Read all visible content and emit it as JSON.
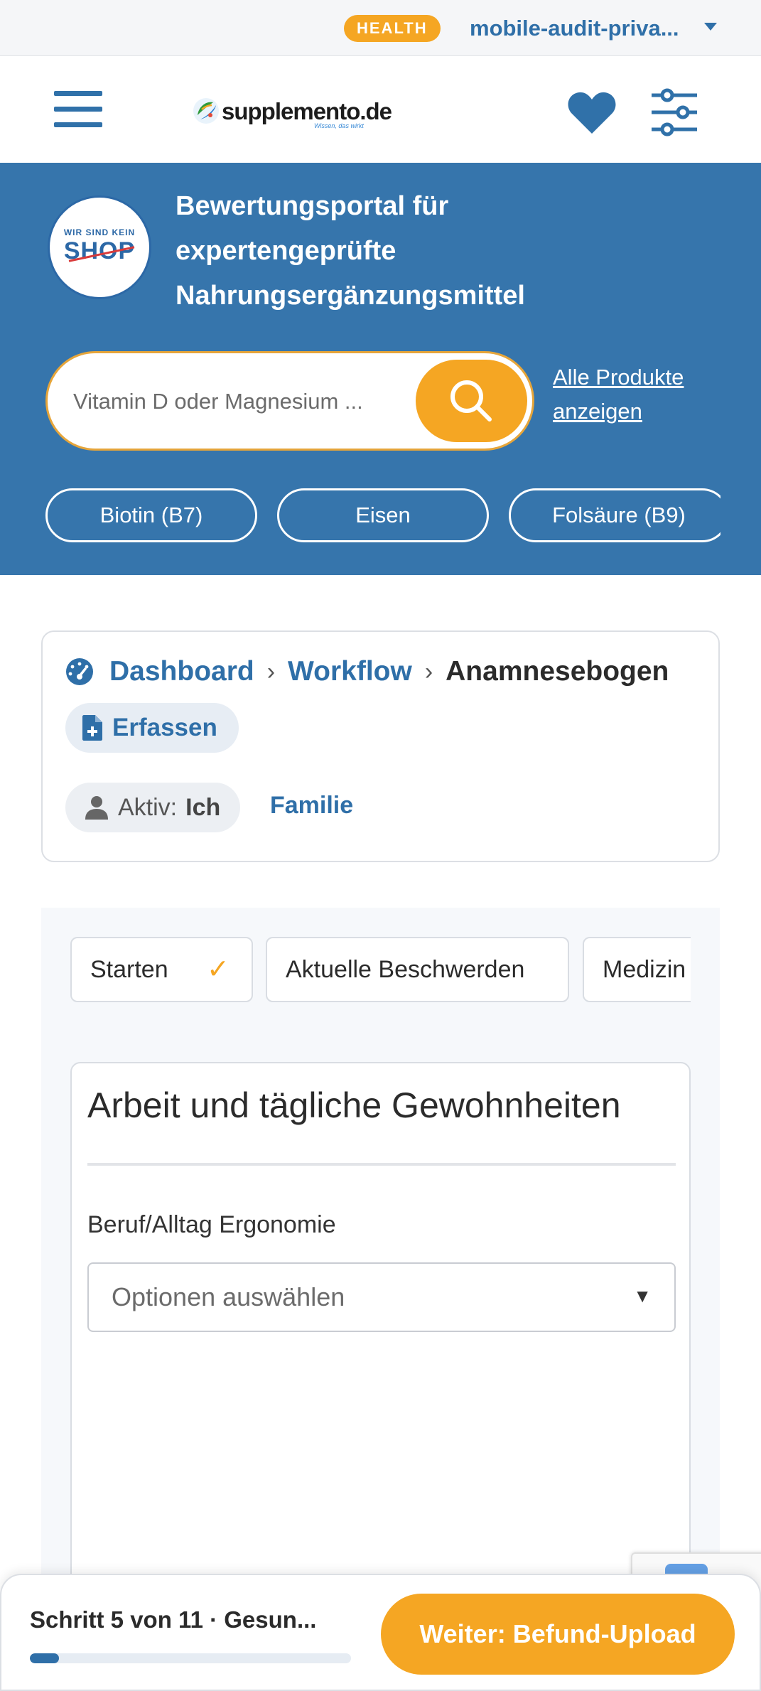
{
  "account_bar": {
    "badge": "HEALTH",
    "account_name": "mobile-audit-priva...",
    "colors": {
      "badge": "#f5a623",
      "link": "#2f6fa8"
    }
  },
  "header": {
    "menu_icon": "hamburger-menu-icon",
    "logo": {
      "name": "supplemento.de",
      "tagline": "Wissen, das wirkt"
    },
    "favorites_icon": "heart-icon",
    "settings_icon": "sliders-icon"
  },
  "hero": {
    "seal": {
      "top": "WIR SIND KEIN",
      "main": "SHOP"
    },
    "title": "Bewertungsportal für expertengeprüfte Nahrungsergänzungsmittel",
    "search": {
      "placeholder": "Vitamin D oder Magnesium ...",
      "icon": "search-icon"
    },
    "all_products_link": "Alle Produkte anzeigen",
    "chips": [
      "Biotin (B7)",
      "Eisen",
      "Folsäure (B9)"
    ],
    "colors": {
      "background": "#3675ac",
      "accent": "#f5a623"
    }
  },
  "breadcrumb": {
    "icon": "dashboard-gauge-icon",
    "items": [
      "Dashboard",
      "Workflow"
    ],
    "current": "Anamnesebogen",
    "separator": "›",
    "action": {
      "label": "Erfassen",
      "icon": "file-plus-icon"
    },
    "profile": {
      "label": "Aktiv:",
      "value": "Ich",
      "icon": "user-icon"
    },
    "other_profile": "Familie"
  },
  "workflow": {
    "steps": [
      {
        "label": "Starten",
        "done": true
      },
      {
        "label": "Aktuelle Beschwerden",
        "done": false
      },
      {
        "label": "Medizin",
        "done": false
      }
    ],
    "question_card": {
      "title": "Arbeit und tägliche Gewohnheiten",
      "field_label": "Beruf/Alltag Ergonomie",
      "select_placeholder": "Optionen auswählen",
      "select_arrow": "▼"
    }
  },
  "footer_bar": {
    "step_text": "Schritt 5 von 11 · Gesun...",
    "progress": 0.09,
    "next_button": "Weiter: Befund-Upload"
  }
}
